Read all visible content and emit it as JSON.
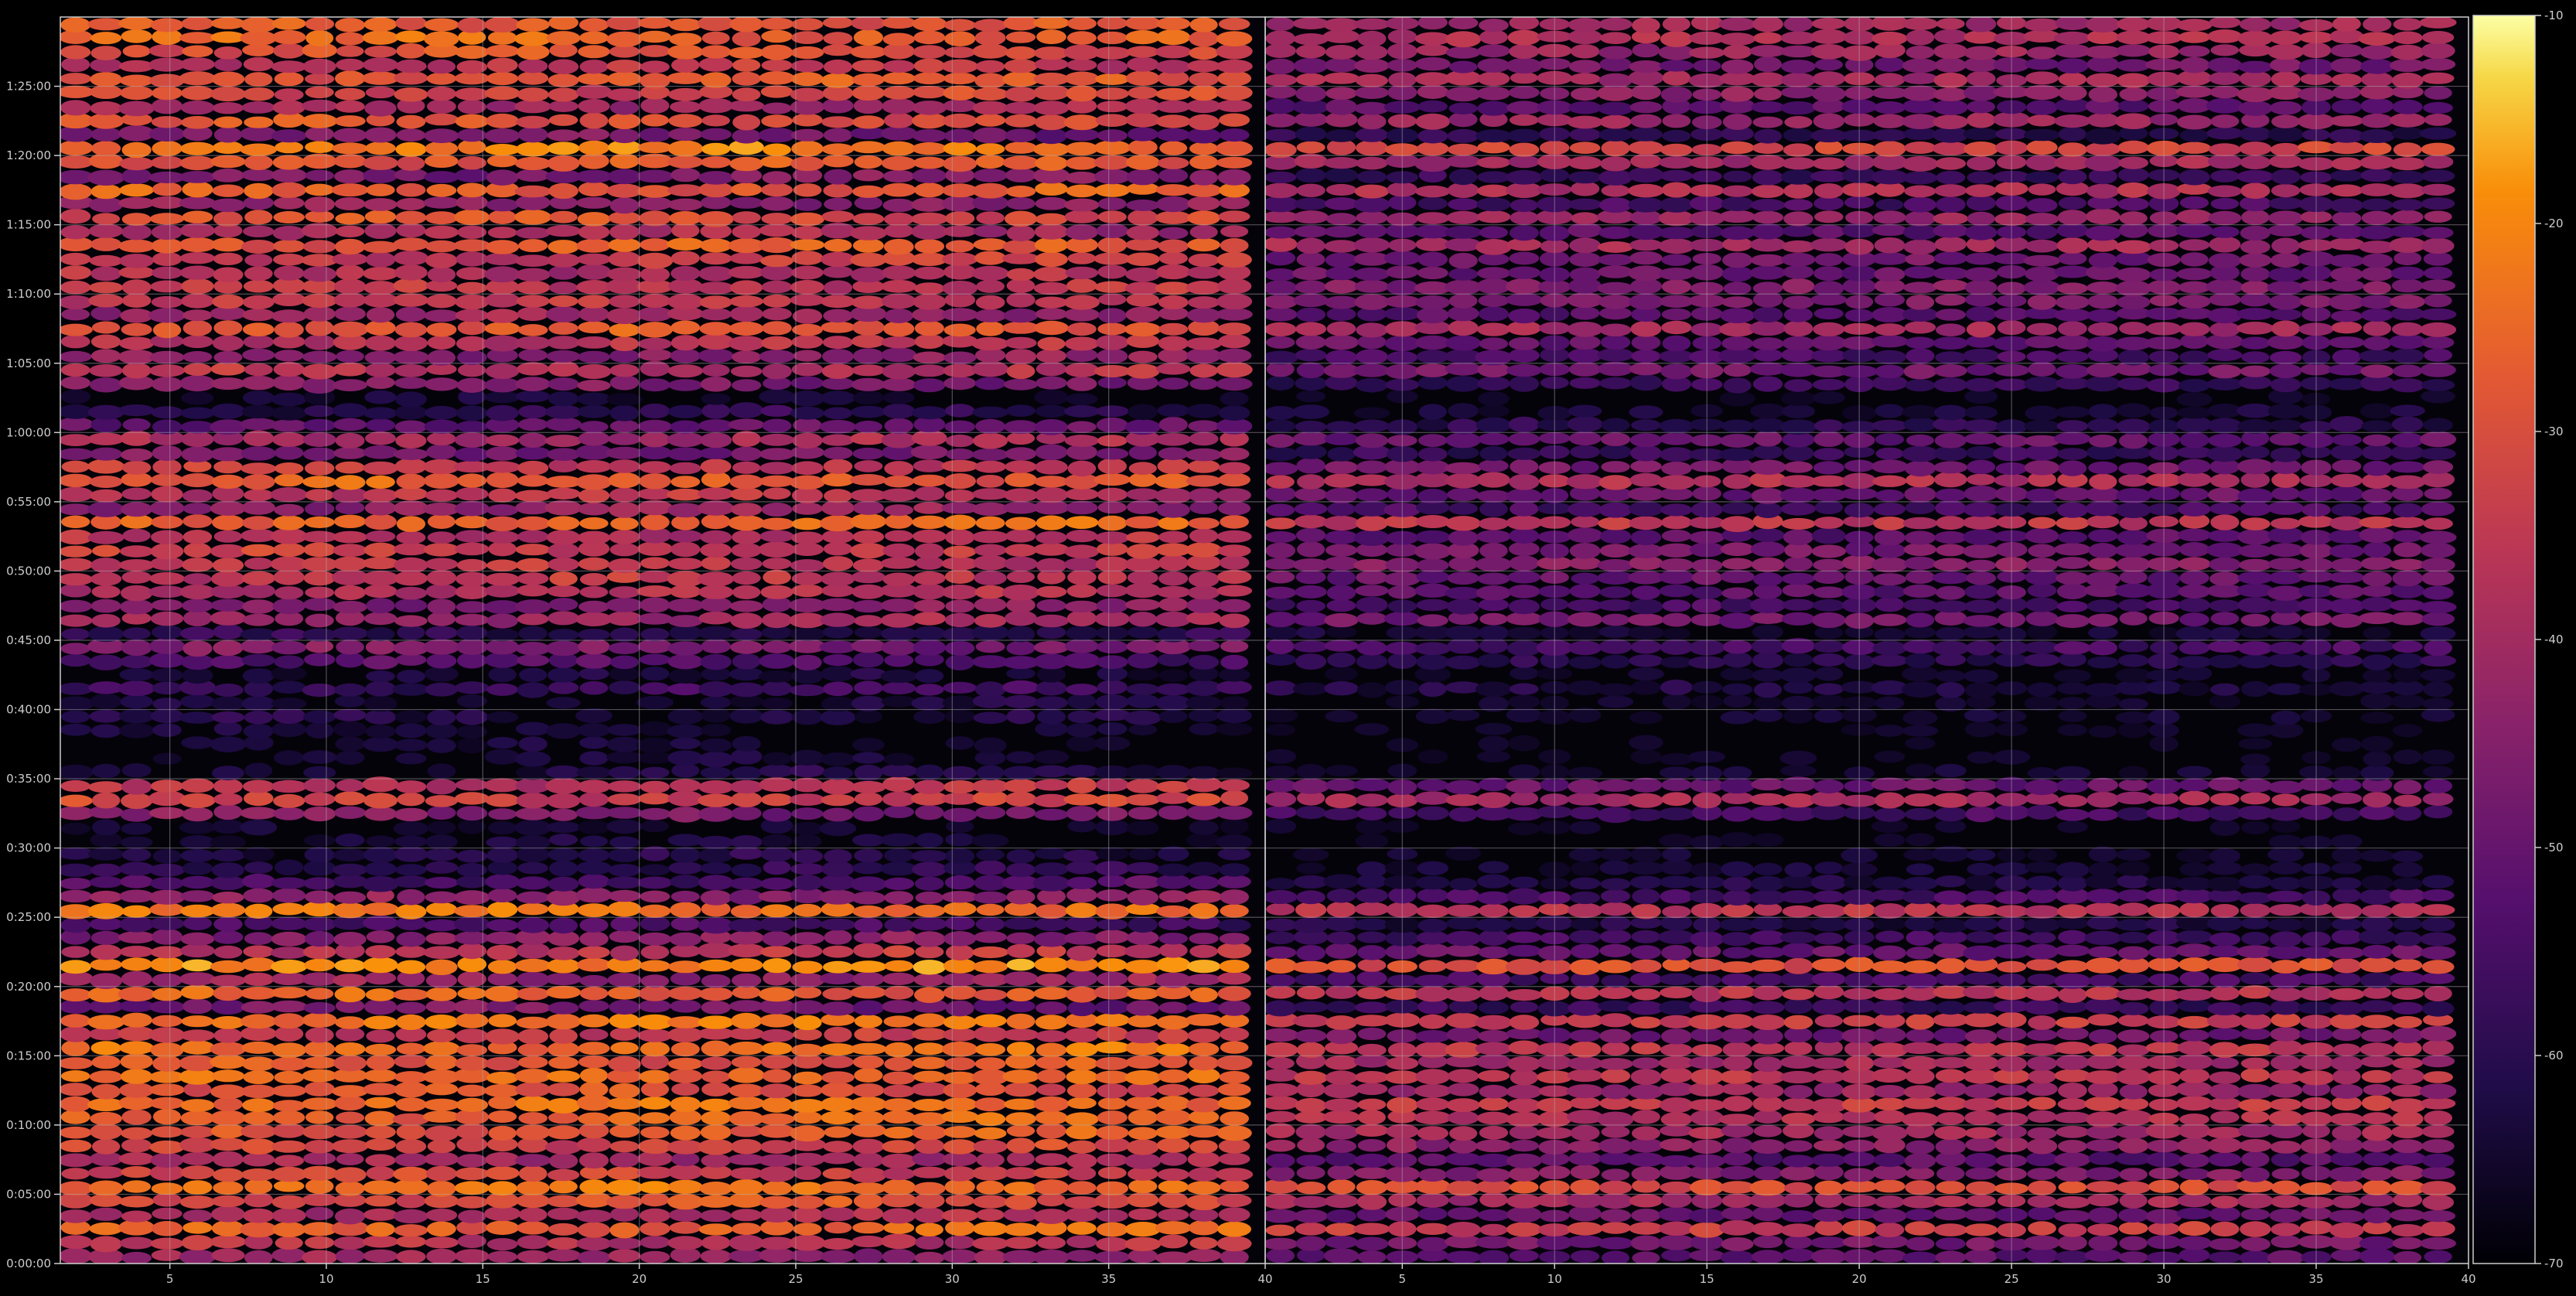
{
  "chart_data": {
    "type": "heatmap",
    "title": "",
    "xlabel": "",
    "ylabel": "",
    "grid": true,
    "colormap": "inferno",
    "background": "#000000",
    "foreground": "#cccccc",
    "y_ticks": [
      "0:00:00",
      "0:05:00",
      "0:10:00",
      "0:15:00",
      "0:20:00",
      "0:25:00",
      "0:30:00",
      "0:35:00",
      "0:40:00",
      "0:45:00",
      "0:50:00",
      "0:55:00",
      "1:00:00",
      "1:05:00",
      "1:10:00",
      "1:15:00",
      "1:20:00",
      "1:25:00"
    ],
    "y_range_seconds": [
      0,
      5400
    ],
    "panels": [
      {
        "name": "left",
        "x_range": [
          1.5,
          40
        ],
        "x_ticks": [
          "5",
          "10",
          "15",
          "20",
          "25",
          "30",
          "35",
          "40"
        ],
        "x_tick_values": [
          5,
          10,
          15,
          20,
          25,
          30,
          35,
          40
        ],
        "channels": [
          1.5,
          39.5
        ]
      },
      {
        "name": "right",
        "x_range": [
          0.5,
          40
        ],
        "x_ticks": [
          "5",
          "10",
          "15",
          "20",
          "25",
          "30",
          "35",
          "40"
        ],
        "x_tick_values": [
          5,
          10,
          15,
          20,
          25,
          30,
          35,
          40
        ],
        "channels": [
          0.5,
          39.5
        ]
      }
    ],
    "colorbar": {
      "range": [
        -70,
        -10
      ],
      "ticks": [
        "-10",
        "-20",
        "-30",
        "-40",
        "-50",
        "-60",
        "-70"
      ],
      "tick_values": [
        -10,
        -20,
        -30,
        -40,
        -50,
        -60,
        -70
      ]
    },
    "row_profile": {
      "time_seconds": [
        0,
        60,
        120,
        180,
        240,
        300,
        360,
        420,
        480,
        540,
        600,
        660,
        720,
        780,
        840,
        900,
        960,
        1020,
        1080,
        1140,
        1200,
        1260,
        1320,
        1380,
        1440,
        1500,
        1560,
        1620,
        1680,
        1740,
        1800,
        1860,
        1920,
        1980,
        2040,
        2100,
        2160,
        2220,
        2280,
        2340,
        2400,
        2460,
        2520,
        2580,
        2640,
        2700,
        2760,
        2820,
        2880,
        2940,
        3000,
        3060,
        3120,
        3180,
        3240,
        3300,
        3360,
        3420,
        3480,
        3540,
        3600,
        3660,
        3720,
        3780,
        3840,
        3900,
        3960,
        4020,
        4080,
        4140,
        4200,
        4260,
        4320,
        4380,
        4440,
        4500,
        4560,
        4620,
        4680,
        4740,
        4800,
        4860,
        4920,
        4980,
        5040,
        5100,
        5160,
        5220,
        5280,
        5340
      ],
      "left_db": [
        -42,
        -37,
        -26,
        -38,
        -30,
        -23,
        -33,
        -40,
        -32,
        -28,
        -26,
        -24,
        -30,
        -25,
        -28,
        -24,
        -35,
        -23,
        -48,
        -27,
        -42,
        -20,
        -36,
        -45,
        -55,
        -23,
        -44,
        -54,
        -60,
        -62,
        -65,
        -66,
        -46,
        -33,
        -36,
        -63,
        -66,
        -66,
        -65,
        -62,
        -64,
        -57,
        -64,
        -54,
        -46,
        -60,
        -40,
        -45,
        -38,
        -36,
        -36,
        -34,
        -38,
        -26,
        -43,
        -37,
        -27,
        -35,
        -47,
        -39,
        -50,
        -60,
        -66,
        -46,
        -37,
        -44,
        -36,
        -28,
        -42,
        -36,
        -36,
        -38,
        -34,
        -28,
        -40,
        -30,
        -44,
        -27,
        -46,
        -28,
        -22,
        -48,
        -30,
        -40,
        -32,
        -28,
        -36,
        -30,
        -26,
        -28
      ],
      "right_db": [
        -52,
        -48,
        -34,
        -50,
        -40,
        -30,
        -46,
        -52,
        -44,
        -40,
        -38,
        -34,
        -42,
        -36,
        -40,
        -36,
        -48,
        -34,
        -58,
        -36,
        -55,
        -30,
        -50,
        -56,
        -62,
        -36,
        -55,
        -62,
        -65,
        -66,
        -68,
        -68,
        -55,
        -40,
        -50,
        -66,
        -68,
        -68,
        -68,
        -66,
        -67,
        -62,
        -67,
        -60,
        -55,
        -64,
        -48,
        -55,
        -52,
        -50,
        -45,
        -48,
        -52,
        -36,
        -55,
        -50,
        -38,
        -48,
        -58,
        -50,
        -60,
        -64,
        -68,
        -58,
        -48,
        -55,
        -50,
        -40,
        -52,
        -46,
        -46,
        -50,
        -48,
        -40,
        -52,
        -42,
        -55,
        -38,
        -58,
        -40,
        -32,
        -60,
        -42,
        -52,
        -44,
        -40,
        -48,
        -42,
        -38,
        -40
      ]
    }
  }
}
